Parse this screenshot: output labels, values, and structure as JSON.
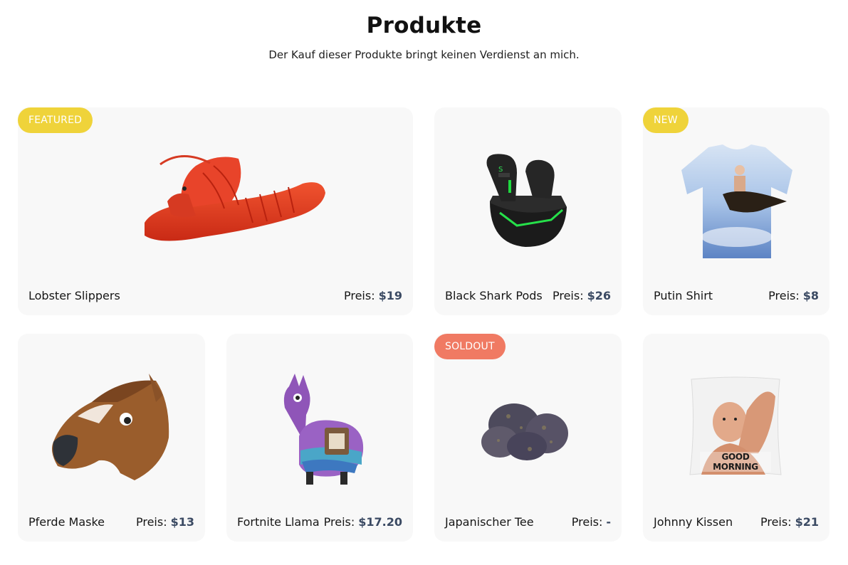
{
  "header": {
    "title": "Produkte",
    "subtitle": "Der Kauf dieser Produkte bringt keinen Verdienst an mich."
  },
  "colors": {
    "badge_yellow": "#efd33a",
    "badge_red": "#f07a63",
    "card_bg": "#f8f8f8",
    "price_accent": "#3b4a63"
  },
  "products": [
    {
      "name": "Lobster Slippers",
      "price_label": "Preis:",
      "price": "$19",
      "badge": "FEATURED",
      "image": "lobster-slipper-image"
    },
    {
      "name": "Black Shark Pods",
      "price_label": "Preis:",
      "price": "$26",
      "badge": "",
      "image": "earbuds-image"
    },
    {
      "name": "Putin Shirt",
      "price_label": "Preis:",
      "price": "$8",
      "badge": "NEW",
      "image": "tshirt-image"
    },
    {
      "name": "Pferde Maske",
      "price_label": "Preis:",
      "price": "$13",
      "badge": "",
      "image": "horse-mask-image"
    },
    {
      "name": "Fortnite Llama",
      "price_label": "Preis:",
      "price": "$17.20",
      "badge": "",
      "image": "llama-plush-image"
    },
    {
      "name": "Japanischer Tee",
      "price_label": "Preis:",
      "price": "-",
      "badge": "SOLDOUT",
      "image": "tea-buds-image"
    },
    {
      "name": "Johnny Kissen",
      "price_label": "Preis:",
      "price": "$21",
      "badge": "",
      "image": "pillow-image",
      "image_text": "GOOD MORNING"
    }
  ]
}
